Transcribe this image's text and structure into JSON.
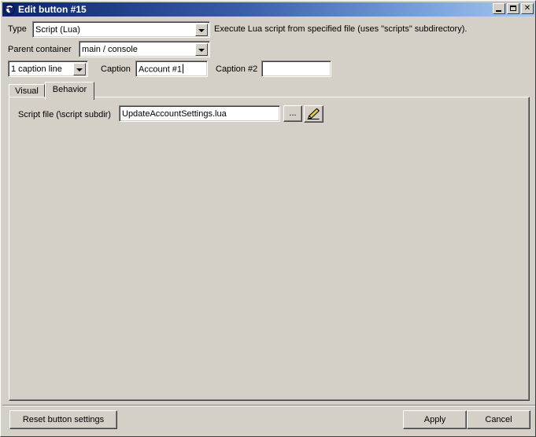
{
  "window": {
    "title": "Edit button #15",
    "icon": "phone-handset-icon",
    "controls": {
      "minimize": "minimize-icon",
      "maximize": "maximize-icon",
      "close": "close-icon"
    }
  },
  "form": {
    "type_label": "Type",
    "type_value": "Script (Lua)",
    "type_description": "Execute Lua script from specified file (uses \"scripts\" subdirectory).",
    "parent_container_label": "Parent container",
    "parent_container_value": "main / console",
    "caption_lines_value": "1 caption line",
    "caption_label": "Caption",
    "caption_value": "Account #1",
    "caption2_label": "Caption #2",
    "caption2_value": "",
    "caption2_placeholder": ""
  },
  "tabs": [
    {
      "label": "Visual",
      "active": false
    },
    {
      "label": "Behavior",
      "active": true
    }
  ],
  "behavior": {
    "script_file_label": "Script file (\\script subdir)",
    "script_file_value": "UpdateAccountSettings.lua",
    "browse_label": "...",
    "edit_icon": "pencil-edit-icon"
  },
  "footer": {
    "reset_label": "Reset button settings",
    "apply_label": "Apply",
    "cancel_label": "Cancel"
  },
  "colors": {
    "face": "#d4d0c8",
    "title_start": "#0a246a",
    "title_end": "#a6caf0",
    "text": "#000000",
    "field_bg": "#ffffff"
  }
}
